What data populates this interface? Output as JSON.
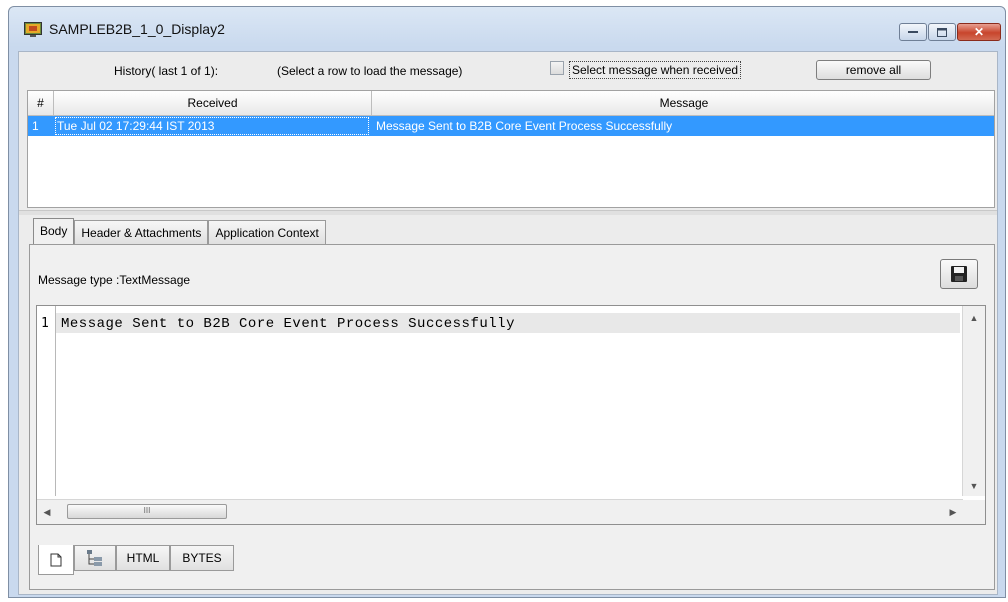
{
  "window": {
    "title": "SAMPLEB2B_1_0_Display2",
    "close_glyph": "✕"
  },
  "history": {
    "label": "History( last 1 of 1):",
    "hint": "(Select a row to load the message)",
    "select_checkbox_label": "Select message when received",
    "select_checkbox_checked": false,
    "remove_all_label": "remove all"
  },
  "table": {
    "columns": [
      "#",
      "Received",
      "Message"
    ],
    "rows": [
      {
        "num": "1",
        "received": "Tue Jul 02 17:29:44 IST 2013",
        "message": "Message Sent to B2B Core Event Process Successfully"
      }
    ]
  },
  "tabs": [
    {
      "label": "Body",
      "active": true
    },
    {
      "label": "Header & Attachments",
      "active": false
    },
    {
      "label": "Application Context",
      "active": false
    }
  ],
  "body": {
    "message_type": "Message type :TextMessage",
    "save_icon": "floppy-disk-icon",
    "line_number": "1",
    "content": "Message Sent to B2B Core Event Process Successfully",
    "hscroll_grip": "III"
  },
  "view_tabs": [
    {
      "label": "",
      "icon": "page-icon",
      "active": true
    },
    {
      "label": "",
      "icon": "xml-tree-icon",
      "active": false
    },
    {
      "label": "HTML",
      "active": false
    },
    {
      "label": "BYTES",
      "active": false
    }
  ]
}
